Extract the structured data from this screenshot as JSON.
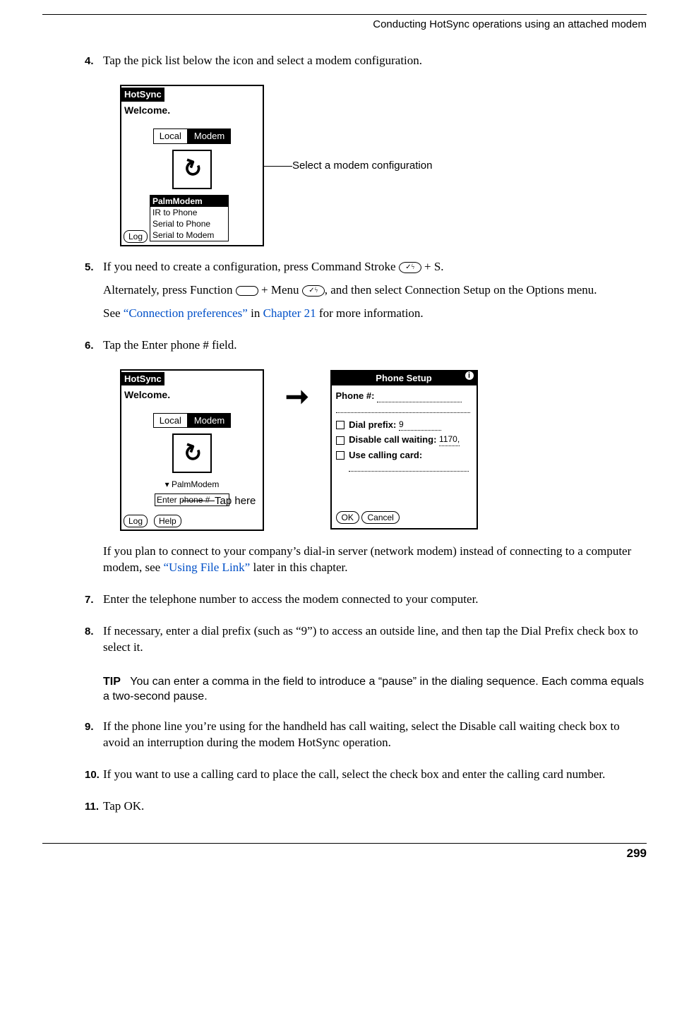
{
  "header": {
    "running": "Conducting HotSync operations using an attached modem"
  },
  "steps": {
    "s4": {
      "num": "4.",
      "text": "Tap the pick list below the icon and select a modem configuration."
    },
    "s5": {
      "num": "5.",
      "line1a": "If you need to create a configuration, press Command Stroke ",
      "line1b": " + S.",
      "line2a": "Alternately, press Function ",
      "line2b": " + Menu ",
      "line2c": ", and then select Connection Setup on the Options menu.",
      "line3a": "See ",
      "link1": "“Connection preferences”",
      "line3b": " in ",
      "link2": "Chapter 21",
      "line3c": " for more information."
    },
    "s6": {
      "num": "6.",
      "text": "Tap the Enter phone # field."
    },
    "s6b": {
      "a": "If you plan to connect to your company’s dial-in server (network modem) instead of connecting to a computer modem, see ",
      "link": "“Using File Link”",
      "b": " later in this chapter."
    },
    "s7": {
      "num": "7.",
      "text": "Enter the telephone number to access the modem connected to your computer."
    },
    "s8": {
      "num": "8.",
      "text": "If necessary, enter a dial prefix (such as “9”) to access an outside line, and then tap the Dial Prefix check box to select it."
    },
    "tip": {
      "label": "TIP",
      "text": "You can enter a comma in the field to introduce a “pause” in the dialing sequence. Each comma equals a two-second pause."
    },
    "s9": {
      "num": "9.",
      "text": "If the phone line you’re using for the handheld has call waiting, select the Disable call waiting check box to avoid an interruption during the modem HotSync operation."
    },
    "s10": {
      "num": "10.",
      "text": "If you want to use a calling card to place the call, select the check box and enter the calling card number."
    },
    "s11": {
      "num": "11.",
      "text": "Tap OK."
    }
  },
  "fig1": {
    "title": "HotSync",
    "welcome": "Welcome.",
    "tab_local": "Local",
    "tab_modem": "Modem",
    "list": [
      "PalmModem",
      "IR to Phone",
      "Serial to Phone",
      "Serial to Modem"
    ],
    "log": "Log",
    "callout": "Select a modem configuration"
  },
  "fig2": {
    "left": {
      "title": "HotSync",
      "welcome": "Welcome.",
      "tab_local": "Local",
      "tab_modem": "Modem",
      "dropdown": "▾ PalmModem",
      "enter_phone": "Enter phone #",
      "log": "Log",
      "help": "Help"
    },
    "tap_here": "Tap here",
    "right": {
      "title": "Phone Setup",
      "phone_label": "Phone #:",
      "dial_prefix": "Dial prefix:",
      "dial_prefix_val": "9",
      "disable_cw": "Disable call waiting:",
      "disable_cw_val": "1170,",
      "calling_card": "Use calling card:",
      "ok": "OK",
      "cancel": "Cancel"
    }
  },
  "footer": {
    "page": "299"
  }
}
